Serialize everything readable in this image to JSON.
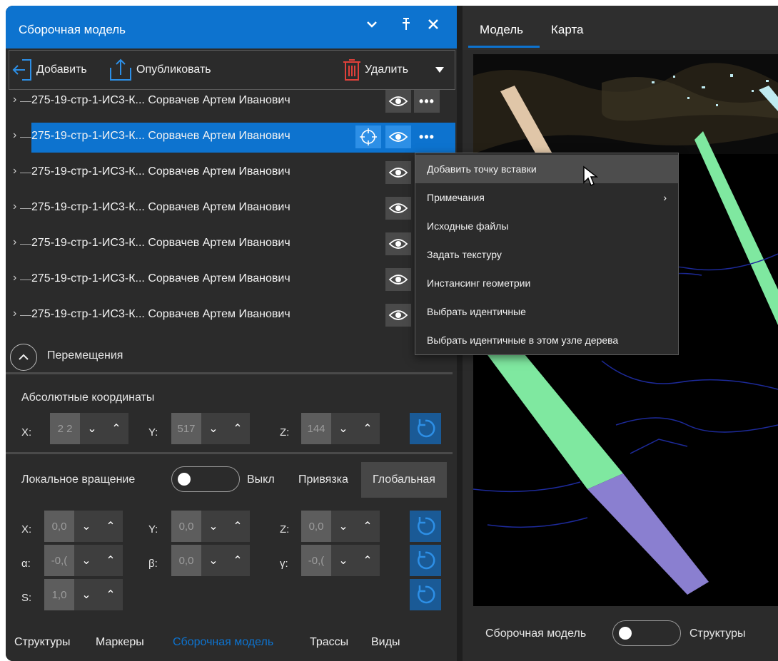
{
  "left_panel": {
    "title": "Сборочная модель",
    "toolbar": {
      "add_label": "Добавить",
      "publish_label": "Опубликовать",
      "delete_label": "Удалить"
    },
    "tree_rows": [
      {
        "name": "275-19-стр-1-ИС3-К...",
        "author": "Сорвачев Артем Иванович"
      },
      {
        "name": "275-19-стр-1-ИС3-К...",
        "author": "Сорвачев Артем Иванович"
      },
      {
        "name": "275-19-стр-1-ИС3-К...",
        "author": "Сорвачев Артем Иванович"
      },
      {
        "name": "275-19-стр-1-ИС3-К...",
        "author": "Сорвачев Артем Иванович"
      },
      {
        "name": "275-19-стр-1-ИС3-К...",
        "author": "Сорвачев Артем Иванович"
      },
      {
        "name": "275-19-стр-1-ИС3-К...",
        "author": "Сорвачев Артем Иванович"
      },
      {
        "name": "275-19-стр-1-ИС3-К...",
        "author": "Сорвачев Артем Иванович"
      }
    ],
    "move_section": {
      "title": "Перемещения",
      "abs_coords_title": "Абсолютные координаты",
      "x_label": "X:",
      "x_value": "2 2",
      "y_label": "Y:",
      "y_value": "517",
      "z_label": "Z:",
      "z_value": "144"
    },
    "rotation": {
      "local_label": "Локальное вращение",
      "toggle_state": "Выкл",
      "snap_label": "Привязка",
      "snap_value": "Глобальная",
      "x_label": "X:",
      "x_value": "0,0",
      "y_label": "Y:",
      "y_value": "0,0",
      "z_label": "Z:",
      "z_value": "0,0",
      "a_label": "α:",
      "a_value": "-0,(",
      "b_label": "β:",
      "b_value": "0,0",
      "g_label": "γ:",
      "g_value": "-0,(",
      "s_label": "S:",
      "s_value": "1,0"
    },
    "bottom_tabs": [
      "Структуры",
      "Маркеры",
      "Сборочная модель",
      "Трассы",
      "Виды"
    ]
  },
  "right_panel": {
    "tabs": [
      "Модель",
      "Карта"
    ],
    "bottom_left_label": "Сборочная модель",
    "bottom_right_label": "Структуры"
  },
  "context_menu": {
    "items": [
      "Добавить точку вставки",
      "Примечания",
      "Исходные файлы",
      "Задать текстуру",
      "Инстансинг геометрии",
      "Выбрать идентичные",
      "Выбрать идентичные в этом узле дерева"
    ]
  },
  "colors": {
    "accent": "#0d73cf",
    "panel_bg": "#2b2b2b",
    "pipe_green": "#7fe8a0",
    "pipe_purple": "#8a7fd0",
    "pipe_beige": "#e0c6a8"
  }
}
